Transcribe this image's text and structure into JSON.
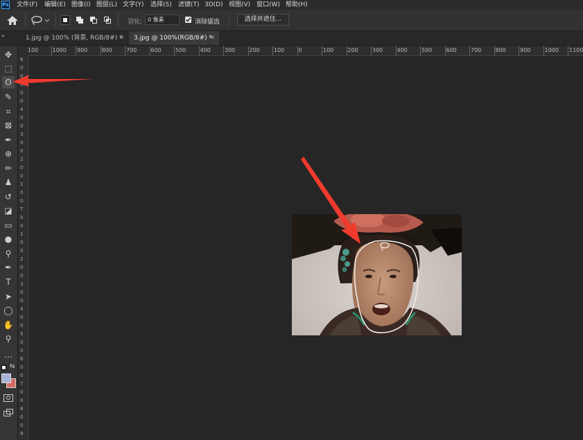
{
  "app": {
    "logo_text": "Ps"
  },
  "menu": [
    "文件(F)",
    "编辑(E)",
    "图像(I)",
    "图层(L)",
    "文字(Y)",
    "选择(S)",
    "滤镜(T)",
    "3D(D)",
    "视图(V)",
    "窗口(W)",
    "帮助(H)"
  ],
  "options": {
    "feather_label": "羽化:",
    "feather_value": "0 像素",
    "antialias_label": "消除锯齿",
    "antialias_checked": true,
    "select_mask_button": "选择并遮住..."
  },
  "tabs": [
    {
      "label": "1.jpg @ 100% (背景, RGB/8#) *",
      "active": false
    },
    {
      "label": "3.jpg @ 100%(RGB/8#) *",
      "active": true
    }
  ],
  "ruler_h": [
    "100",
    "1000",
    "900",
    "800",
    "700",
    "600",
    "500",
    "400",
    "300",
    "200",
    "100",
    "0",
    "100",
    "200",
    "300",
    "400",
    "500",
    "600",
    "700",
    "800",
    "900",
    "1000",
    "1100"
  ],
  "ruler_v": [
    "6",
    "0",
    "0",
    "5",
    "0",
    "0",
    "4",
    "0",
    "0",
    "3",
    "0",
    "0",
    "2",
    "0",
    "0",
    "1",
    "0",
    "0",
    "T",
    "0",
    "0",
    "1",
    "0",
    "0",
    "2",
    "0",
    "0",
    "3",
    "0",
    "0",
    "4",
    "0",
    "0",
    "5",
    "0",
    "0",
    "6",
    "0",
    "0",
    "7",
    "0",
    "0",
    "8",
    "0",
    "0",
    "9"
  ],
  "tools": [
    {
      "name": "move-tool",
      "glyph": "✥"
    },
    {
      "name": "marquee-tool",
      "glyph": "⬚"
    },
    {
      "name": "lasso-tool",
      "glyph": "ʘ",
      "active": true
    },
    {
      "name": "quick-select-tool",
      "glyph": "✎"
    },
    {
      "name": "crop-tool",
      "glyph": "⌗"
    },
    {
      "name": "frame-tool",
      "glyph": "⊠"
    },
    {
      "name": "eyedropper-tool",
      "glyph": "✒"
    },
    {
      "name": "healing-brush-tool",
      "glyph": "⊕"
    },
    {
      "name": "brush-tool",
      "glyph": "✏"
    },
    {
      "name": "clone-stamp-tool",
      "glyph": "♟"
    },
    {
      "name": "history-brush-tool",
      "glyph": "↺"
    },
    {
      "name": "eraser-tool",
      "glyph": "◪"
    },
    {
      "name": "gradient-tool",
      "glyph": "▭"
    },
    {
      "name": "blur-tool",
      "glyph": "●"
    },
    {
      "name": "dodge-tool",
      "glyph": "⚲"
    },
    {
      "name": "pen-tool",
      "glyph": "✒"
    },
    {
      "name": "type-tool",
      "glyph": "T"
    },
    {
      "name": "path-select-tool",
      "glyph": "➤"
    },
    {
      "name": "shape-tool",
      "glyph": "◯"
    },
    {
      "name": "hand-tool",
      "glyph": "✋"
    },
    {
      "name": "zoom-tool",
      "glyph": "⚲"
    },
    {
      "name": "more-tools",
      "glyph": "…"
    }
  ],
  "colors": {
    "foreground": "#a9b4d9",
    "background": "#d46a63",
    "accent_arrow": "#f03a2e",
    "canvas": "#262626"
  }
}
